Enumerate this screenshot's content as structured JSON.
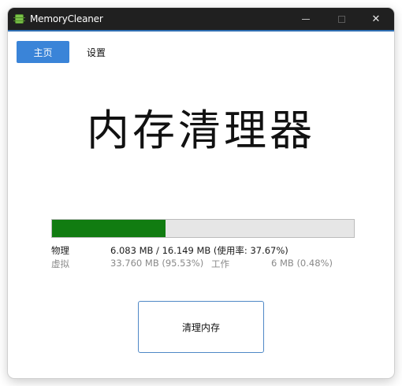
{
  "window": {
    "title": "MemoryCleaner",
    "icon": "memory-chip-icon",
    "controls": {
      "minimize": "—",
      "maximize": "☐",
      "close": "✕"
    }
  },
  "tabs": [
    {
      "label": "主页",
      "active": true
    },
    {
      "label": "设置",
      "active": false
    }
  ],
  "main": {
    "heading": "内存清理器",
    "usage_percent": 37.67,
    "physical": {
      "label": "物理",
      "value": "6.083 MB / 16.149 MB (使用率: 37.67%)"
    },
    "virtual": {
      "label": "虚拟",
      "value": "33.760 MB (95.53%)",
      "work_label": "工作",
      "work_value": "6 MB (0.48%)"
    },
    "clean_button": "清理内存"
  },
  "colors": {
    "accent": "#3a84d8",
    "progress": "#117c11",
    "titlebar": "#202020"
  }
}
